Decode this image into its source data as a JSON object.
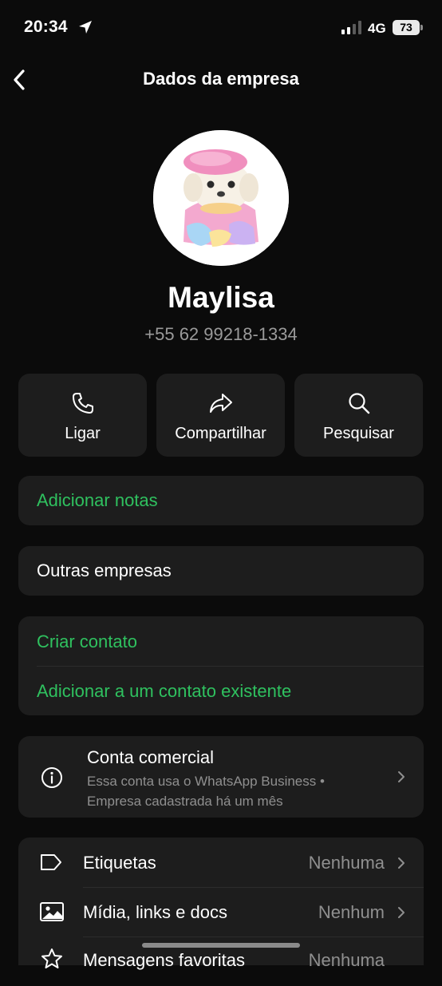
{
  "status_bar": {
    "time": "20:34",
    "network": "4G",
    "battery": "73"
  },
  "nav": {
    "title": "Dados da empresa"
  },
  "profile": {
    "name": "Maylisa",
    "phone": "+55 62 99218-1334"
  },
  "actions": [
    {
      "label": "Ligar",
      "icon": "phone-icon"
    },
    {
      "label": "Compartilhar",
      "icon": "share-icon"
    },
    {
      "label": "Pesquisar",
      "icon": "search-icon"
    }
  ],
  "notes": {
    "label": "Adicionar notas"
  },
  "other_companies": {
    "label": "Outras empresas"
  },
  "contact": {
    "create": "Criar contato",
    "add_existing": "Adicionar a um contato existente"
  },
  "business": {
    "title": "Conta comercial",
    "subtitle": "Essa conta usa o WhatsApp Business • Empresa cadastrada há um mês"
  },
  "list": [
    {
      "label": "Etiquetas",
      "value": "Nenhuma",
      "icon": "label-icon"
    },
    {
      "label": "Mídia, links e docs",
      "value": "Nenhum",
      "icon": "image-icon"
    },
    {
      "label": "Mensagens favoritas",
      "value": "Nenhuma",
      "icon": "star-icon"
    }
  ],
  "colors": {
    "background": "#0b0b0b",
    "card": "#1d1d1d",
    "accent": "#2fc15f",
    "secondary_text": "#8f8f8f"
  }
}
